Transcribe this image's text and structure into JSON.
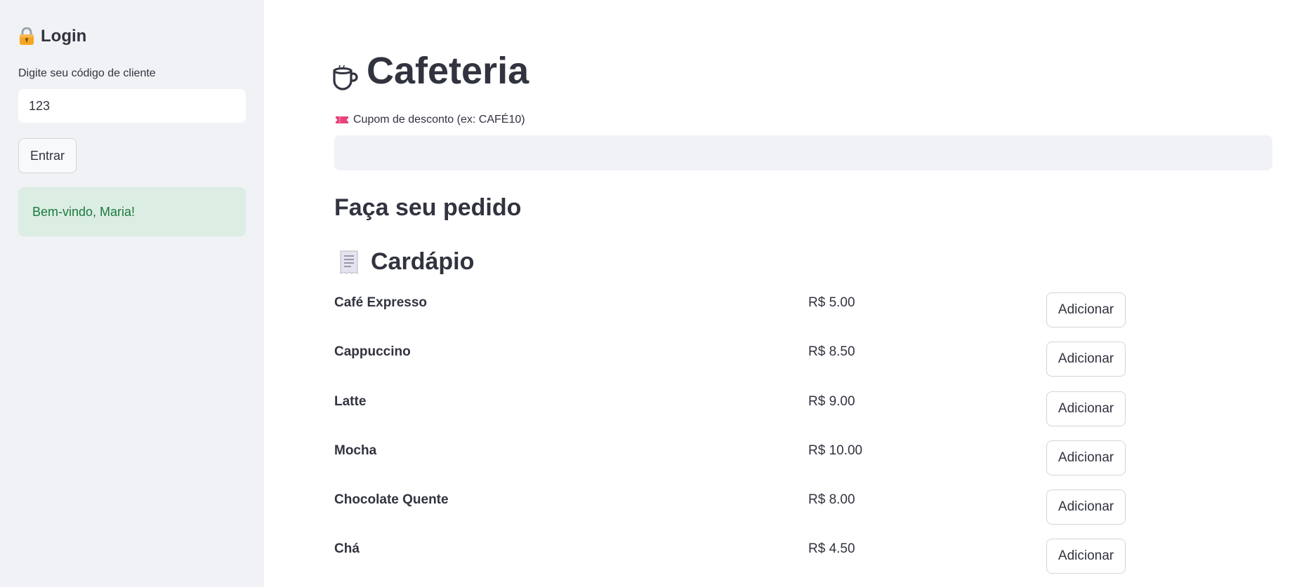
{
  "sidebar": {
    "login_title": "Login",
    "lock_icon": "lock-icon",
    "client_code_label": "Digite seu código de cliente",
    "client_code_value": "123",
    "enter_button": "Entrar",
    "welcome_message": "Bem-vindo, Maria!"
  },
  "main": {
    "title": "Cafeteria",
    "title_icon": "coffee-cup-icon",
    "coupon": {
      "icon": "ticket-icon",
      "label": "Cupom de desconto (ex: CAFÉ10)",
      "value": ""
    },
    "order_heading": "Faça seu pedido",
    "menu_heading": "Cardápio",
    "menu_icon": "receipt-icon",
    "add_label": "Adicionar",
    "items": [
      {
        "name": "Café Expresso",
        "price": "R$ 5.00"
      },
      {
        "name": "Cappuccino",
        "price": "R$ 8.50"
      },
      {
        "name": "Latte",
        "price": "R$ 9.00"
      },
      {
        "name": "Mocha",
        "price": "R$ 10.00"
      },
      {
        "name": "Chocolate Quente",
        "price": "R$ 8.00"
      },
      {
        "name": "Chá",
        "price": "R$ 4.50"
      }
    ]
  },
  "colors": {
    "sidebar_bg": "#f0f2f6",
    "text": "#31333f",
    "success_bg": "#dcede3",
    "success_text": "#1a7a3e"
  }
}
